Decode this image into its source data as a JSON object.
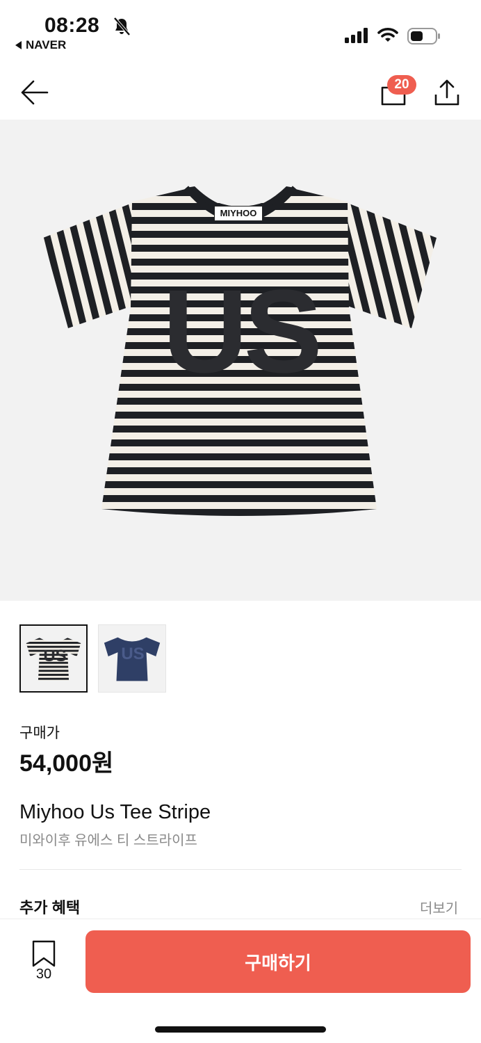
{
  "status_bar": {
    "time": "08:28",
    "back_app": "NAVER"
  },
  "nav": {
    "cart_count": "20"
  },
  "product_image": {
    "tag_text": "MIYHOO",
    "print_text": "US"
  },
  "thumbnails": [
    {
      "print_text": "US",
      "selected": true
    },
    {
      "print_text": "US",
      "selected": false
    }
  ],
  "price": {
    "label": "구매가",
    "value": "54,000원"
  },
  "product": {
    "name_en": "Miyhoo Us Tee Stripe",
    "name_ko": "미와이후 유에스 티 스트라이프"
  },
  "benefit": {
    "label": "추가 혜택",
    "more": "더보기"
  },
  "bottom_bar": {
    "bookmark_count": "30",
    "buy_label": "구매하기"
  },
  "colors": {
    "accent": "#ef5e50",
    "navy_variant": "#2f3f66"
  }
}
